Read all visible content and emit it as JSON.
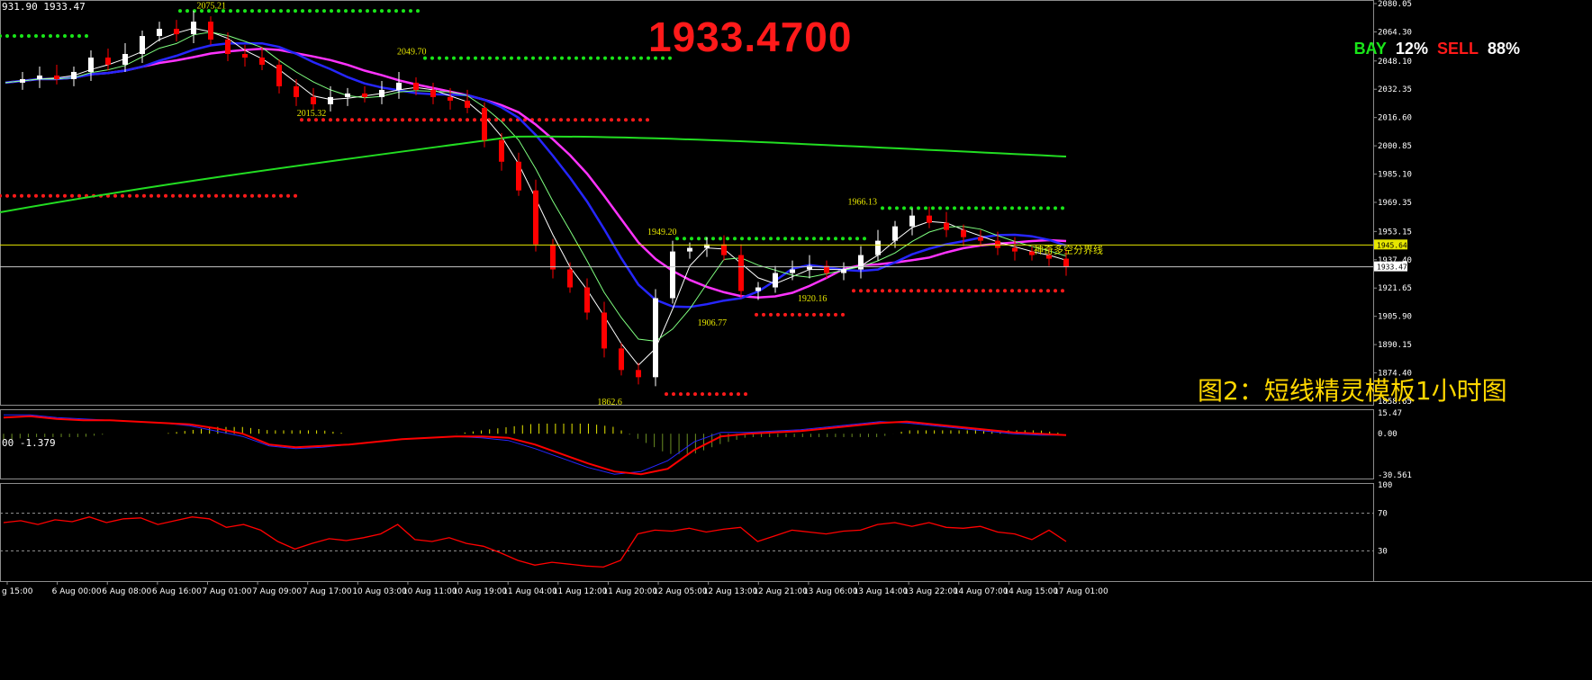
{
  "header": {
    "symbol_info": "931.90 1933.47",
    "big_price": "1933.4700",
    "bay_label": "BAY",
    "bay_value": "12%",
    "sell_label": "SELL",
    "sell_value": "88%",
    "caption": "图2：短线精灵模板1小时图"
  },
  "colors": {
    "background": "#000000",
    "bull": "#ffffff",
    "bear": "#ff0000",
    "ma_blue": "#2626ff",
    "ma_magenta": "#ff33ff",
    "ma_green": "#22dd22",
    "green_dots": "#19e619",
    "red_dots": "#ff1a1a",
    "price_line": "#c8c8c8",
    "level_line": "#e6e600"
  },
  "chart_data": [
    {
      "type": "candlestick",
      "panel": "price",
      "ylim": [
        1858.65,
        2080.05
      ],
      "y_ticks": [
        "2080.05",
        "2064.30",
        "2048.10",
        "2032.35",
        "2016.60",
        "2000.85",
        "1985.10",
        "1969.35",
        "1953.15",
        "1937.40",
        "1921.65",
        "1905.90",
        "1890.15",
        "1874.40",
        "1858.65"
      ],
      "current_price": "1933.47",
      "level_price": "1945.64",
      "level_label": "神奇多空分界线",
      "swing_labels": [
        {
          "text": "2075.21",
          "x": "7 Aug 01:00",
          "y": 2075.21
        },
        {
          "text": "2049.70",
          "x": "10 Aug 11:00",
          "y": 2049.7
        },
        {
          "text": "2015.32",
          "x": "7 Aug 17:00",
          "y": 2015.32
        },
        {
          "text": "1949.20",
          "x": "12 Aug 05:00",
          "y": 1949.2
        },
        {
          "text": "1966.13",
          "x": "13 Aug 14:00",
          "y": 1966.13
        },
        {
          "text": "1906.77",
          "x": "12 Aug 13:00",
          "y": 1906.77
        },
        {
          "text": "1920.16",
          "x": "13 Aug 06:00",
          "y": 1920.16
        },
        {
          "text": "1862.6",
          "x": "11 Aug 20:00",
          "y": 1862.6
        }
      ],
      "x_labels": [
        "g 15:00",
        "6 Aug 00:00",
        "6 Aug 08:00",
        "6 Aug 16:00",
        "7 Aug 01:00",
        "7 Aug 09:00",
        "7 Aug 17:00",
        "10 Aug 03:00",
        "10 Aug 11:00",
        "10 Aug 19:00",
        "11 Aug 04:00",
        "11 Aug 12:00",
        "11 Aug 20:00",
        "12 Aug 05:00",
        "12 Aug 13:00",
        "12 Aug 21:00",
        "13 Aug 06:00",
        "13 Aug 14:00",
        "13 Aug 22:00",
        "14 Aug 07:00",
        "14 Aug 15:00",
        "17 Aug 01:00"
      ],
      "close_path": [
        2036,
        2038,
        2040,
        2038,
        2042,
        2050,
        2046,
        2052,
        2062,
        2066,
        2063,
        2070,
        2060,
        2052,
        2050,
        2046,
        2034,
        2028,
        2024,
        2028,
        2030,
        2028,
        2032,
        2036,
        2032,
        2028,
        2026,
        2022,
        2004,
        1992,
        1976,
        1946,
        1932,
        1922,
        1908,
        1888,
        1876,
        1872,
        1916,
        1942,
        1944,
        1946,
        1940,
        1920,
        1922,
        1930,
        1932,
        1934,
        1930,
        1932,
        1940,
        1948,
        1956,
        1962,
        1958,
        1954,
        1950,
        1948,
        1944,
        1942,
        1940,
        1938,
        1933.47
      ]
    },
    {
      "type": "line",
      "panel": "macd",
      "info": "00 -1.379",
      "ylim": [
        -30.561,
        15.47
      ],
      "y_ticks": [
        "15.47",
        "0.00",
        "-30.561"
      ],
      "series": [
        {
          "color": "#ff0000",
          "values": [
            12,
            13,
            11,
            10,
            10,
            9,
            8,
            7,
            4,
            0,
            -8,
            -10,
            -9,
            -8,
            -6,
            -4,
            -3,
            -2,
            -2,
            -3,
            -8,
            -15,
            -22,
            -28,
            -30,
            -26,
            -12,
            -2,
            0,
            1,
            2,
            4,
            6,
            8,
            9,
            7,
            5,
            3,
            1,
            0,
            -1
          ]
        },
        {
          "color": "#2626ff",
          "values": [
            14,
            14,
            12,
            11,
            10,
            9,
            8,
            6,
            2,
            -2,
            -9,
            -11,
            -10,
            -8,
            -6,
            -4,
            -3,
            -2,
            -3,
            -5,
            -11,
            -18,
            -25,
            -30,
            -28,
            -20,
            -6,
            1,
            1,
            2,
            3,
            5,
            7,
            9,
            8,
            6,
            4,
            2,
            0,
            -1,
            -1
          ]
        }
      ]
    },
    {
      "type": "line",
      "panel": "rsi",
      "ylim": [
        0,
        100
      ],
      "y_ticks": [
        "100",
        "70",
        "30"
      ],
      "series": [
        {
          "color": "#ff0000",
          "values": [
            60,
            62,
            58,
            63,
            61,
            66,
            60,
            64,
            65,
            58,
            62,
            66,
            64,
            55,
            58,
            52,
            40,
            32,
            38,
            43,
            41,
            44,
            48,
            58,
            42,
            40,
            44,
            38,
            35,
            28,
            20,
            15,
            18,
            16,
            14,
            13,
            20,
            48,
            52,
            51,
            54,
            50,
            53,
            55,
            40,
            46,
            52,
            50,
            48,
            51,
            52,
            58,
            60,
            56,
            60,
            55,
            54,
            56,
            50,
            48,
            42,
            52,
            40
          ]
        }
      ]
    }
  ]
}
